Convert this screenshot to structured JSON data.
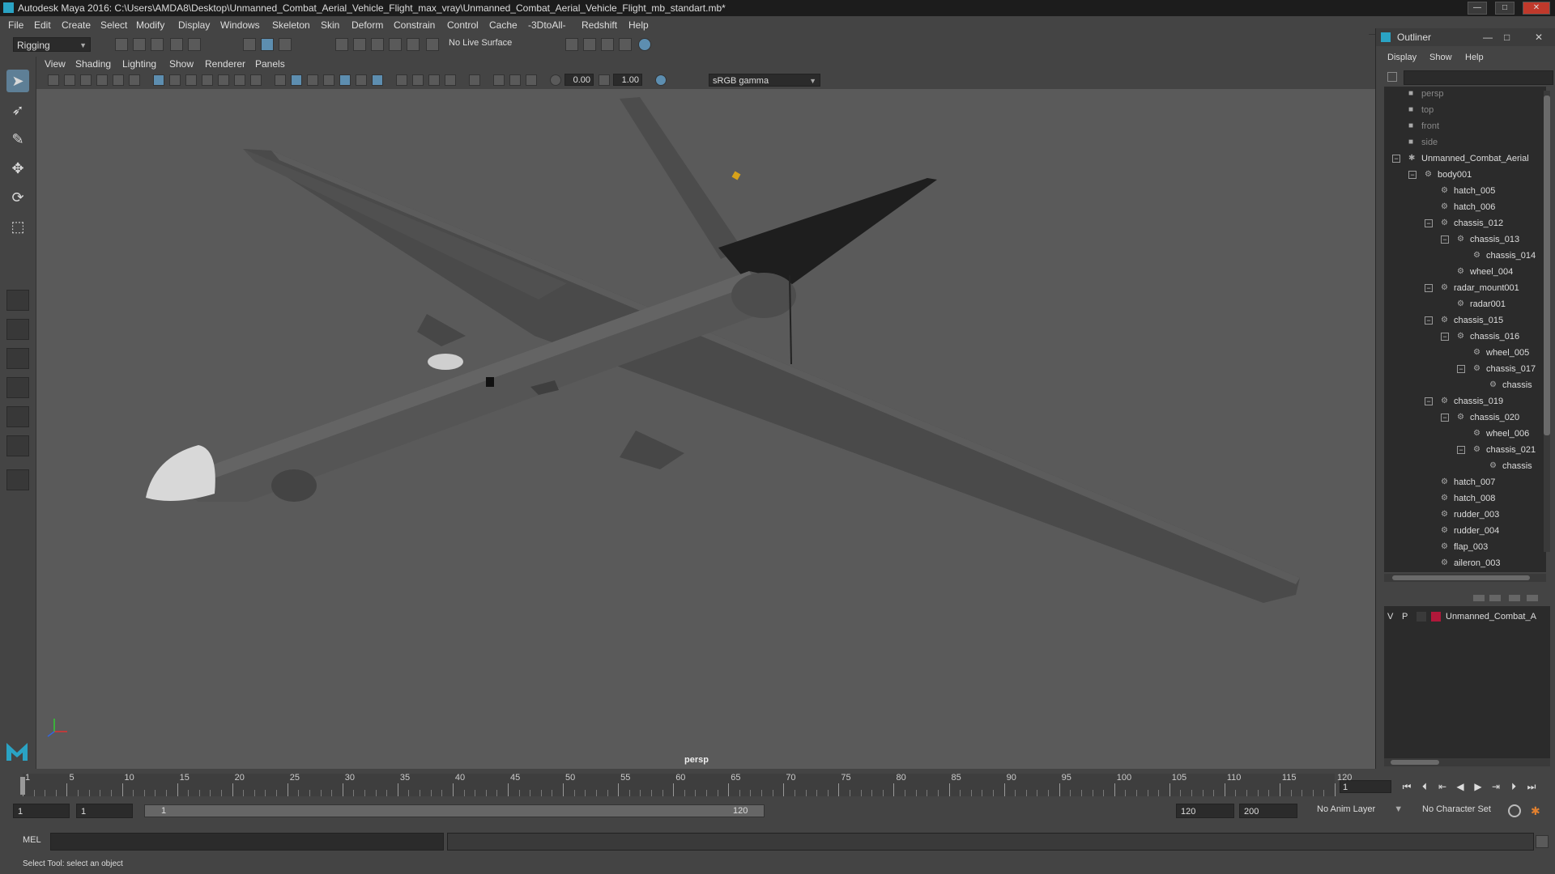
{
  "window": {
    "title": "Autodesk Maya 2016: C:\\Users\\AMDA8\\Desktop\\Unmanned_Combat_Aerial_Vehicle_Flight_max_vray\\Unmanned_Combat_Aerial_Vehicle_Flight_mb_standart.mb*",
    "controls": [
      "minimize-icon",
      "maximize-icon",
      "close-icon"
    ]
  },
  "menubar": {
    "items": [
      "File",
      "Edit",
      "Create",
      "Select",
      "Modify",
      "Display",
      "Windows",
      "Skeleton",
      "Skin",
      "Deform",
      "Constrain",
      "Control",
      "Cache",
      "-3DtoAll-",
      "Redshift",
      "Help"
    ]
  },
  "shelf": {
    "mode": "Rigging",
    "live_surface": "No Live Surface"
  },
  "viewport": {
    "menu": [
      "View",
      "Shading",
      "Lighting",
      "Show",
      "Renderer",
      "Panels"
    ],
    "exposure": "0.00",
    "gamma_value": "1.00",
    "color_space": "sRGB gamma",
    "camera_label": "persp"
  },
  "outliner": {
    "title": "Outliner",
    "menu": [
      "Display",
      "Show",
      "Help"
    ],
    "items": [
      {
        "label": "persp",
        "depth": 1,
        "kind": "camera",
        "dim": true
      },
      {
        "label": "top",
        "depth": 1,
        "kind": "camera",
        "dim": true
      },
      {
        "label": "front",
        "depth": 1,
        "kind": "camera",
        "dim": true
      },
      {
        "label": "side",
        "depth": 1,
        "kind": "camera",
        "dim": true
      },
      {
        "label": "Unmanned_Combat_Aerial",
        "depth": 1,
        "kind": "group",
        "expanded": true
      },
      {
        "label": "body001",
        "depth": 2,
        "kind": "mesh",
        "expanded": true
      },
      {
        "label": "hatch_005",
        "depth": 3,
        "kind": "mesh"
      },
      {
        "label": "hatch_006",
        "depth": 3,
        "kind": "mesh"
      },
      {
        "label": "chassis_012",
        "depth": 3,
        "kind": "mesh",
        "expanded": true
      },
      {
        "label": "chassis_013",
        "depth": 4,
        "kind": "mesh",
        "expanded": true
      },
      {
        "label": "chassis_014",
        "depth": 5,
        "kind": "mesh"
      },
      {
        "label": "wheel_004",
        "depth": 4,
        "kind": "mesh"
      },
      {
        "label": "radar_mount001",
        "depth": 3,
        "kind": "mesh",
        "expanded": true
      },
      {
        "label": "radar001",
        "depth": 4,
        "kind": "mesh"
      },
      {
        "label": "chassis_015",
        "depth": 3,
        "kind": "mesh",
        "expanded": true
      },
      {
        "label": "chassis_016",
        "depth": 4,
        "kind": "mesh",
        "expanded": true
      },
      {
        "label": "wheel_005",
        "depth": 5,
        "kind": "mesh"
      },
      {
        "label": "chassis_017",
        "depth": 5,
        "kind": "mesh",
        "expanded": true
      },
      {
        "label": "chassis",
        "depth": 6,
        "kind": "mesh"
      },
      {
        "label": "chassis_019",
        "depth": 3,
        "kind": "mesh",
        "expanded": true
      },
      {
        "label": "chassis_020",
        "depth": 4,
        "kind": "mesh",
        "expanded": true
      },
      {
        "label": "wheel_006",
        "depth": 5,
        "kind": "mesh"
      },
      {
        "label": "chassis_021",
        "depth": 5,
        "kind": "mesh",
        "expanded": true
      },
      {
        "label": "chassis",
        "depth": 6,
        "kind": "mesh"
      },
      {
        "label": "hatch_007",
        "depth": 3,
        "kind": "mesh"
      },
      {
        "label": "hatch_008",
        "depth": 3,
        "kind": "mesh"
      },
      {
        "label": "rudder_003",
        "depth": 3,
        "kind": "mesh"
      },
      {
        "label": "rudder_004",
        "depth": 3,
        "kind": "mesh"
      },
      {
        "label": "flap_003",
        "depth": 3,
        "kind": "mesh"
      },
      {
        "label": "aileron_003",
        "depth": 3,
        "kind": "mesh"
      }
    ]
  },
  "layers": {
    "row": {
      "v": "V",
      "p": "P",
      "name": "Unmanned_Combat_A",
      "color": "#b0183a"
    }
  },
  "timeline": {
    "ticks": [
      1,
      5,
      10,
      15,
      20,
      25,
      30,
      35,
      40,
      45,
      50,
      55,
      60,
      65,
      70,
      75,
      80,
      85,
      90,
      95,
      100,
      105,
      110,
      115,
      120
    ],
    "current_frame": "1",
    "range_start_min": "1",
    "range_start": "1",
    "range_bar_start": "1",
    "range_bar_end": "120",
    "range_end": "120",
    "range_end_max": "200",
    "anim_layer": "No Anim Layer",
    "character_set": "No Character Set"
  },
  "command": {
    "mel_label": "MEL"
  },
  "help_line": "Select Tool: select an object",
  "colors": {
    "background": "#444444",
    "viewport": "#5a5a5a",
    "accent": "#5d8eb0"
  }
}
